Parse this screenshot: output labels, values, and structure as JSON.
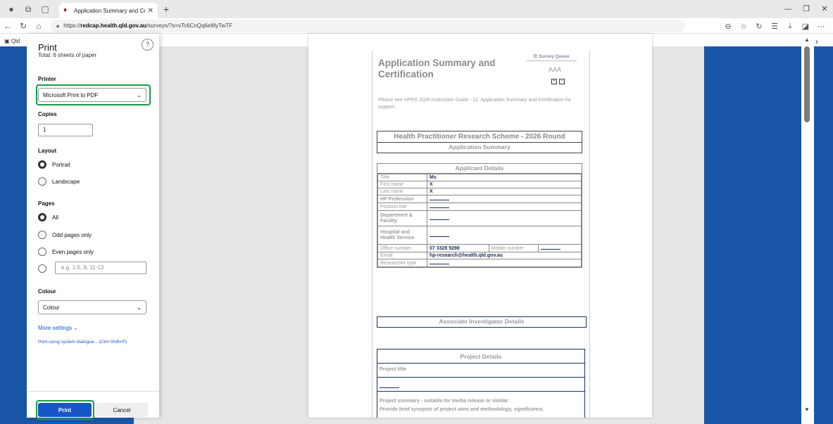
{
  "browser": {
    "tab_title": "Application Summary and Certific",
    "tab_close": "✕",
    "new_tab": "+",
    "url_prefix": "https://",
    "url_host": "redcap.health.qld.gov.au",
    "url_path": "/surveys/?s=vTc6CnQq6eMyTwTF",
    "favbar_label": "Qld"
  },
  "print": {
    "title": "Print",
    "help": "?",
    "sheets": "Total: 6 sheets of paper",
    "printer_label": "Printer",
    "printer_value": "Microsoft Print to PDF",
    "copies_label": "Copies",
    "copies_value": "1",
    "layout_label": "Layout",
    "portrait": "Portrait",
    "landscape": "Landscape",
    "pages_label": "Pages",
    "pages_all": "All",
    "pages_odd": "Odd pages only",
    "pages_even": "Even pages only",
    "pages_custom_placeholder": "e.g. 1-5, 8, 11-13",
    "colour_label": "Colour",
    "colour_value": "Colour",
    "more_settings": "More settings ⌄",
    "system_dialog": "Print using system dialogue... (Ctrl+Shift+P)",
    "print_button": "Print",
    "cancel_button": "Cancel"
  },
  "preview": {
    "title": "Application Summary and Certification",
    "survey_queue": "☰ Survey Queue",
    "font_sizes": "AAA",
    "instruction_pre": "Please see ",
    "instruction_italic": "HPRS 2026 Instruction Guide",
    "instruction_post": " - 11. Application Summary and Certification for support.",
    "scheme_title": "Health Practitioner Research Scheme - 2026 Round",
    "app_summary": "Application Summary",
    "applicant_details": "Applicant Details",
    "fields": {
      "title_label": "Title",
      "title_value": "Ms",
      "first_label": "First name",
      "first_value": "X",
      "last_label": "Last name",
      "last_value": "X",
      "prof_label": "HP Profession",
      "pos_label": "Position title",
      "dept_label": "Department & Facility",
      "hhs_label": "Hosptial and Health Service",
      "office_label": "Office number",
      "office_value": "07 3328 9298",
      "mobile_label": "Mobile number",
      "email_label": "Email",
      "email_value": "hp-research@health.qld.gov.au",
      "rtype_label": "Researcher type"
    },
    "associate": "Associate Investigator Details",
    "project_details": "Project Details",
    "project_title": "Project title",
    "project_summary": "Project summary - suitable for media release or similar",
    "project_synopsis": "Provide brief synopsis of project aims and methodology, significance,"
  }
}
